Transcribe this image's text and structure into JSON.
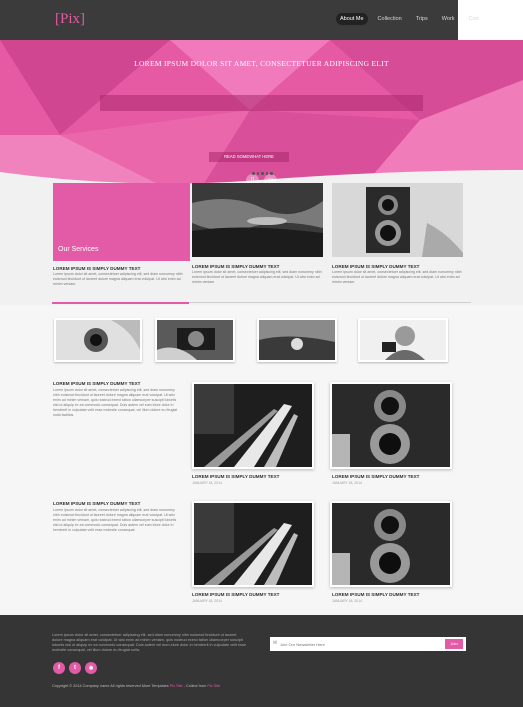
{
  "header": {
    "logo": "[Pix]",
    "nav": [
      "About Me",
      "Collection",
      "Trips",
      "Work",
      "Con"
    ]
  },
  "hero": {
    "title": "LOREM IPSUM DOLOR SIT AMET, CONSECTETUER ADIPISCING ELIT",
    "button_label": "READ SOMEWHAT HERE",
    "icons": [
      "phone-icon",
      "tablet-icon"
    ],
    "dots": 5
  },
  "services": {
    "label": "Our Services",
    "cards": [
      {
        "title": "LOREM IPSUM IS SIMPLY DUMMY TEXT",
        "text": "Lorem ipsum dolor sit amet, consectetuer adipiscing elit, sed diam nonummy nibh euismod tincidunt ut laoreet dolore magna aliquam erat volutpat. Ut wisi enim ad minim veniam."
      },
      {
        "title": "LOREM IPSUM IS SIMPLY DUMMY TEXT",
        "text": "Lorem ipsum dolor sit amet, consectetuer adipiscing elit, sed diam nonummy nibh euismod tincidunt ut laoreet dolore magna aliquam erat volutpat. Ut wisi enim ad minim veniam."
      },
      {
        "title": "LOREM IPSUM IS SIMPLY DUMMY TEXT",
        "text": "Lorem ipsum dolor sit amet, consectetuer adipiscing elit, sed diam nonummy nibh euismod tincidunt ut laoreet dolore magna aliquam erat volutpat. Ut wisi enim ad minim veniam."
      }
    ]
  },
  "gallery": {
    "blocks": [
      {
        "title": "LOREM IPSUM IS SIMPLY DUMMY TEXT",
        "text": "Lorem ipsum dolor sit amet, consectetuer adipiscing elit, sed diam nonummy nibh euismod tincidunt ut laoreet dolore magna aliquam erat volutpat. Ut wisi enim ad minim veniam, quis nostrud exerci tation ullamcorper suscipit lobortis nisl ut aliquip ex ea commodo consequat. Duis autem vel eum iriure dolor in hendrerit in vulputate velit esse molestie consequat, vel illum dolore eu feugiat nulla facilisis.",
        "items": [
          {
            "title": "LOREM IPSUM IS SIMPLY DUMMY TEXT",
            "date": "JANUARY 18, 2014"
          },
          {
            "title": "LOREM IPSUM IS SIMPLY DUMMY TEXT",
            "date": "JANUARY 18, 2014"
          }
        ]
      },
      {
        "title": "LOREM IPSUM IS SIMPLY DUMMY TEXT",
        "text": "Lorem ipsum dolor sit amet, consectetuer adipiscing elit, sed diam nonummy nibh euismod tincidunt ut laoreet dolore magna aliquam erat volutpat. Ut wisi enim ad minim veniam, quis nostrud exerci tation ullamcorper suscipit lobortis nisl ut aliquip ex ea commodo consequat. Duis autem vel eum iriure dolor in hendrerit in vulputate velit esse molestie consequat.",
        "items": [
          {
            "title": "LOREM IPSUM IS SIMPLY DUMMY TEXT",
            "date": "JANUARY 18, 2014"
          },
          {
            "title": "LOREM IPSUM IS SIMPLY DUMMY TEXT",
            "date": "JANUARY 18, 2014"
          }
        ]
      }
    ]
  },
  "footer": {
    "text": "Lorem ipsum dolor sit amet, consectetuer adipiscing elit, sed diam nonummy nibh euismod tincidunt ut laoreet dolore magna aliquam erat volutpat. Ut wisi enim ad minim veniam, quis nostrud exerci tation ullamcorper suscipit lobortis nisl ut aliquip ex ea commodo consequat. Duis autem vel eum iriure dolor in hendrerit in vulputate velit esse molestie consequat, vel illum dolore eu feugiat nulla.",
    "social": [
      "f",
      "t",
      "rss"
    ],
    "newsletter_placeholder": "Join Our Newsletter Here",
    "newsletter_button": "Join",
    "copyright_prefix": "Copyright © 2014 Company name All rights reserved More Templates ",
    "copyright_link1": "Pix Site",
    "copyright_mid": " - Collect from ",
    "copyright_link2": "Pix Site"
  },
  "colors": {
    "accent": "#e35aa6",
    "dark": "#353535",
    "header": "#3b3b3b"
  }
}
